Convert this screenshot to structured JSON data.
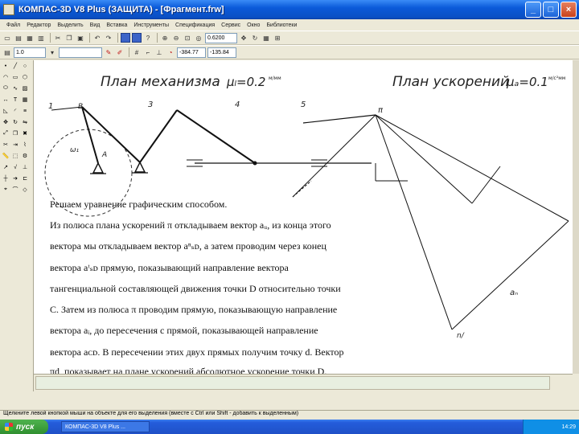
{
  "window": {
    "title": "КОМПАС-3D V8 Plus (ЗАЩИТА) - [Фрагмент.frw]",
    "minimize_glyph": "_",
    "maximize_glyph": "□",
    "close_glyph": "×"
  },
  "menu": {
    "items": [
      "Файл",
      "Редактор",
      "Выделить",
      "Вид",
      "Вставка",
      "Инструменты",
      "Спецификация",
      "Сервис",
      "Окно",
      "Библиотеки"
    ]
  },
  "toolbar": {
    "scale_value": "0.6200",
    "line_width": "1.0",
    "coord_x": "-384.77",
    "coord_y": "-135.84"
  },
  "drawing": {
    "plan_mechanism_label": "План механизма",
    "plan_mechanism_scale": "μₗ=0.2",
    "plan_mechanism_unit": "м/мм",
    "plan_accel_label": "План ускорений",
    "plan_accel_scale": "μₐ=0.1",
    "plan_accel_unit": "м/с²мм",
    "link_labels": [
      "1",
      "3",
      "4",
      "5"
    ],
    "point_a": "A",
    "point_b": "B",
    "omega": "ω₁",
    "pi_label": "π",
    "n_label": "n/",
    "a_label": "aₙ"
  },
  "document_text": {
    "line1": "Решаем уравнение графическим способом.",
    "line2": "Из полюса плана ускорений π откладываем вектор aᵤ, из конца этого",
    "line3": "вектора мы откладываем вектор aⁿₛᴅ, а затем проводим через конец",
    "line4": "вектора aᵗₛᴅ прямую, показывающий направление вектора",
    "line5": "тангенциальной составляющей движения точки D относительно точки",
    "line6": "C. Затем из полюса π проводим прямую, показывающую направление",
    "line7": "вектора aᵢ, до пересечения с прямой, показывающей направление",
    "line8": "вектора aᴄᴅ. В пересечении этих двух прямых получим точку d. Вектор",
    "line9": "πd, показывает на плане ускорений абсолютное ускорение точки D."
  },
  "status": {
    "text": "Щелкните левой кнопкой мыши на объекте для его выделения (вместе с Ctrl или Shift - добавить к выделенным)"
  },
  "taskbar": {
    "start_label": "пуск",
    "app_item": "КОМПАС-3D V8 Plus ...",
    "clock": "14:29"
  }
}
